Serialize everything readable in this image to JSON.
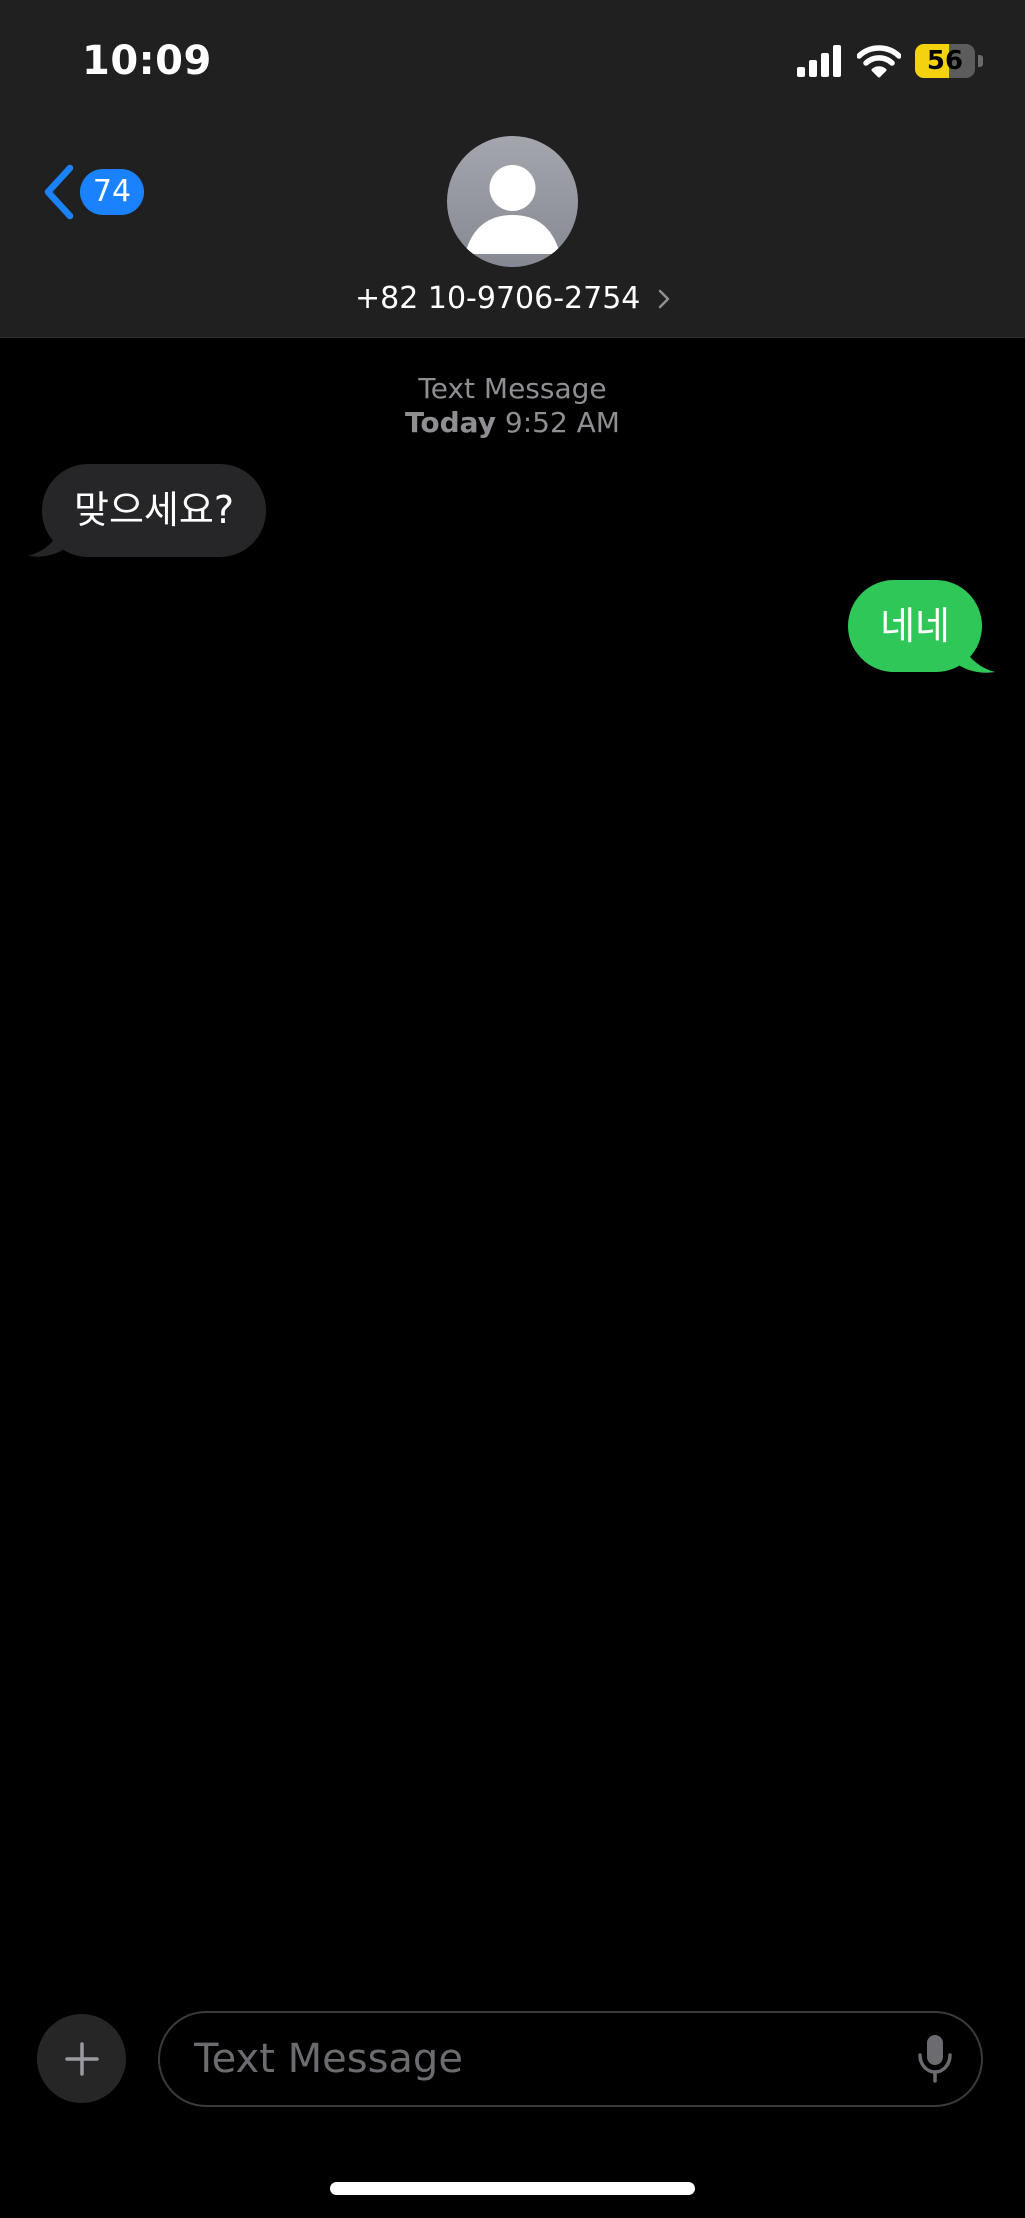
{
  "status_bar": {
    "time": "10:09",
    "battery_percent": "56",
    "battery_level": 0.56,
    "battery_color": "#f5d20e"
  },
  "nav": {
    "back_count": "74",
    "contact_number": "+82 10-9706-2754"
  },
  "thread": {
    "service_label": "Text Message",
    "day_label": "Today",
    "time_label": "9:52 AM",
    "messages": [
      {
        "direction": "incoming",
        "text": "맞으세요?"
      },
      {
        "direction": "outgoing",
        "text": "네네"
      }
    ]
  },
  "composer": {
    "placeholder": "Text Message"
  },
  "colors": {
    "accent": "#1a82ff",
    "sms_bubble": "#30c759",
    "incoming_bubble": "#262628"
  }
}
